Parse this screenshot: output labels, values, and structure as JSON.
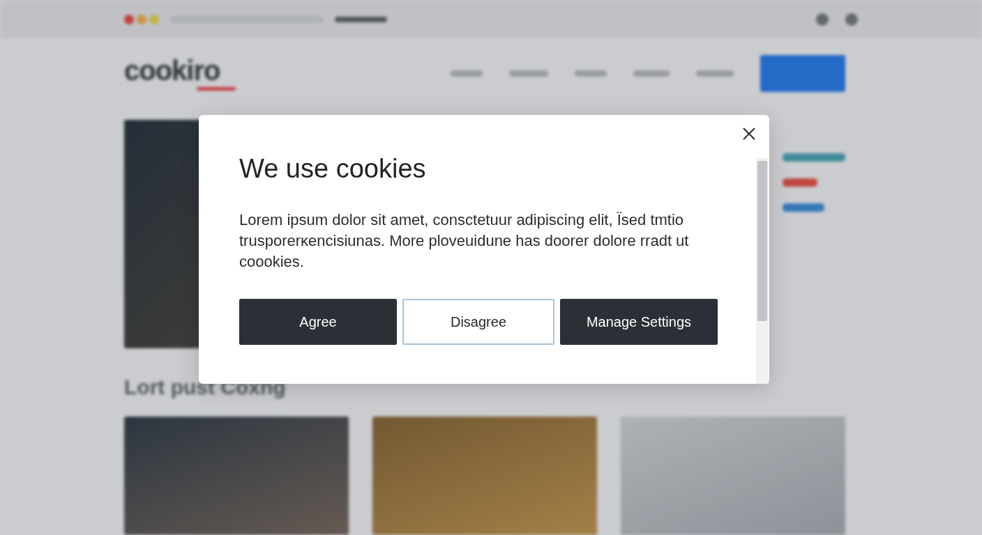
{
  "site": {
    "logo": "cookiro",
    "section_title": "Lort pust Coxng"
  },
  "modal": {
    "title": "We use cookies",
    "body": "Lorem ipsum dolor sit amet, consctetuur adipiscing elit, Ïsed tmtio trusporerκencisiunas. More ploveuidune has doorer dolore rradt ut coookies.",
    "buttons": [
      {
        "label": "Agree",
        "kind": "dark"
      },
      {
        "label": "Disagree",
        "kind": "outline"
      },
      {
        "label": "Manage Settings",
        "kind": "dark"
      }
    ]
  }
}
